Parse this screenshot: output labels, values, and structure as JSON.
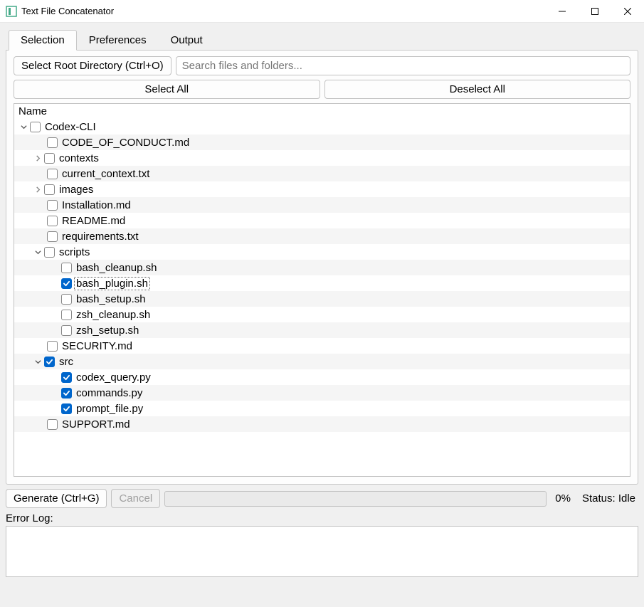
{
  "window": {
    "title": "Text File Concatenator"
  },
  "tabs": {
    "t0": "Selection",
    "t1": "Preferences",
    "t2": "Output"
  },
  "toolbar": {
    "select_root": "Select Root Directory (Ctrl+O)",
    "search_placeholder": "Search files and folders...",
    "select_all": "Select All",
    "deselect_all": "Deselect All"
  },
  "tree": {
    "header": "Name",
    "rows": [
      {
        "depth": 0,
        "caret": "down",
        "checked": false,
        "label": "Codex-CLI"
      },
      {
        "depth": 1,
        "caret": "none",
        "checked": false,
        "label": "CODE_OF_CONDUCT.md"
      },
      {
        "depth": 1,
        "caret": "right",
        "checked": false,
        "label": "contexts"
      },
      {
        "depth": 1,
        "caret": "none",
        "checked": false,
        "label": "current_context.txt"
      },
      {
        "depth": 1,
        "caret": "right",
        "checked": false,
        "label": "images"
      },
      {
        "depth": 1,
        "caret": "none",
        "checked": false,
        "label": "Installation.md"
      },
      {
        "depth": 1,
        "caret": "none",
        "checked": false,
        "label": "README.md"
      },
      {
        "depth": 1,
        "caret": "none",
        "checked": false,
        "label": "requirements.txt"
      },
      {
        "depth": 1,
        "caret": "down",
        "checked": false,
        "label": "scripts"
      },
      {
        "depth": 2,
        "caret": "none",
        "checked": false,
        "label": "bash_cleanup.sh"
      },
      {
        "depth": 2,
        "caret": "none",
        "checked": true,
        "label": "bash_plugin.sh",
        "selected": true
      },
      {
        "depth": 2,
        "caret": "none",
        "checked": false,
        "label": "bash_setup.sh"
      },
      {
        "depth": 2,
        "caret": "none",
        "checked": false,
        "label": "zsh_cleanup.sh"
      },
      {
        "depth": 2,
        "caret": "none",
        "checked": false,
        "label": "zsh_setup.sh"
      },
      {
        "depth": 1,
        "caret": "none",
        "checked": false,
        "label": "SECURITY.md"
      },
      {
        "depth": 1,
        "caret": "down",
        "checked": true,
        "label": "src"
      },
      {
        "depth": 2,
        "caret": "none",
        "checked": true,
        "label": "codex_query.py"
      },
      {
        "depth": 2,
        "caret": "none",
        "checked": true,
        "label": "commands.py"
      },
      {
        "depth": 2,
        "caret": "none",
        "checked": true,
        "label": "prompt_file.py"
      },
      {
        "depth": 1,
        "caret": "none",
        "checked": false,
        "label": "SUPPORT.md"
      }
    ]
  },
  "footer": {
    "generate": "Generate (Ctrl+G)",
    "cancel": "Cancel",
    "percent": "0%",
    "status": "Status: Idle",
    "error_label": "Error Log:"
  }
}
